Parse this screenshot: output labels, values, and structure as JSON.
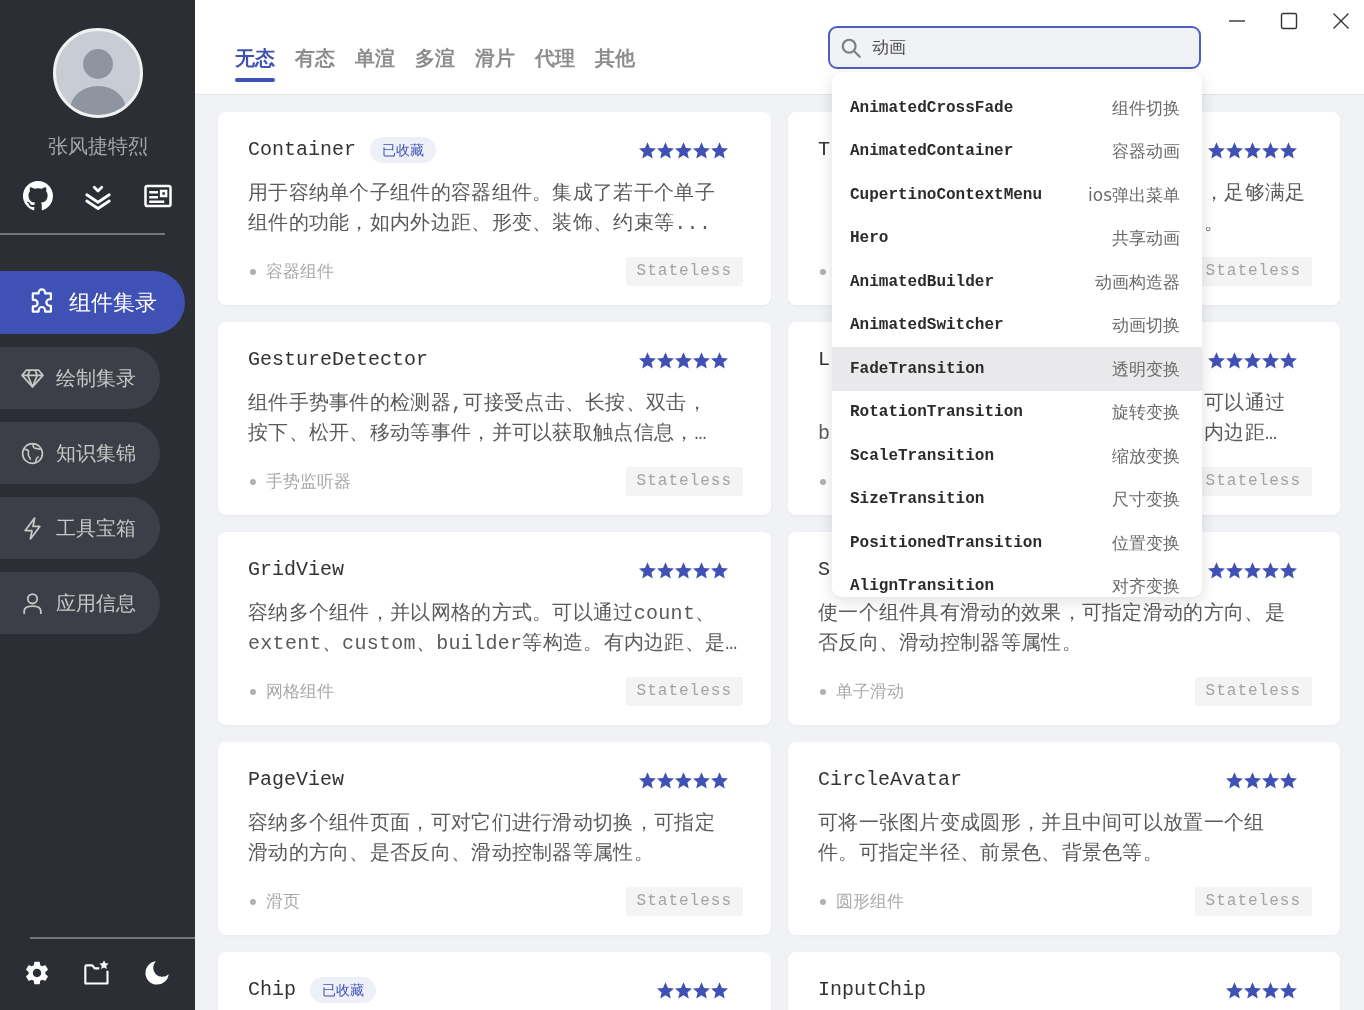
{
  "sidebar": {
    "user_name": "张风捷特烈",
    "nav": [
      {
        "label": "组件集录",
        "selected": true
      },
      {
        "label": "绘制集录",
        "selected": false
      },
      {
        "label": "知识集锦",
        "selected": false
      },
      {
        "label": "工具宝箱",
        "selected": false
      },
      {
        "label": "应用信息",
        "selected": false
      }
    ]
  },
  "tabs": [
    {
      "label": "无态",
      "selected": true
    },
    {
      "label": "有态",
      "selected": false
    },
    {
      "label": "单渲",
      "selected": false
    },
    {
      "label": "多渲",
      "selected": false
    },
    {
      "label": "滑片",
      "selected": false
    },
    {
      "label": "代理",
      "selected": false
    },
    {
      "label": "其他",
      "selected": false
    }
  ],
  "search": {
    "value": "动画"
  },
  "suggestions": [
    {
      "name": "AnimatedCrossFade",
      "summary": "组件切换",
      "highlighted": false
    },
    {
      "name": "AnimatedContainer",
      "summary": "容器动画",
      "highlighted": false
    },
    {
      "name": "CupertinoContextMenu",
      "summary": "ios弹出菜单",
      "highlighted": false
    },
    {
      "name": "Hero",
      "summary": "共享动画",
      "highlighted": false
    },
    {
      "name": "AnimatedBuilder",
      "summary": "动画构造器",
      "highlighted": false
    },
    {
      "name": "AnimatedSwitcher",
      "summary": "动画切换",
      "highlighted": false
    },
    {
      "name": "FadeTransition",
      "summary": "透明变换",
      "highlighted": true
    },
    {
      "name": "RotationTransition",
      "summary": "旋转变换",
      "highlighted": false
    },
    {
      "name": "ScaleTransition",
      "summary": "缩放变换",
      "highlighted": false
    },
    {
      "name": "SizeTransition",
      "summary": "尺寸变换",
      "highlighted": false
    },
    {
      "name": "PositionedTransition",
      "summary": "位置变换",
      "highlighted": false
    },
    {
      "name": "AlignTransition",
      "summary": "对齐变换",
      "highlighted": false
    }
  ],
  "cards": [
    {
      "kind": "full",
      "title": "Container",
      "favorite": "已收藏",
      "stars": 5,
      "description_lines": [
        "用于容纳单个子组件的容器组件。集成了若干个单子",
        "组件的功能，如内外边距、形变、装饰、约束等..."
      ],
      "tag": "容器组件",
      "badge": "Stateless"
    },
    {
      "kind": "covered",
      "title": "T",
      "stars": 5,
      "lines": [
        {
          "after": "，足够满足"
        },
        {
          "after": "。"
        }
      ],
      "badge": "Stateless"
    },
    {
      "kind": "full",
      "title": "GestureDetector",
      "stars": 5,
      "description_lines": [
        "组件手势事件的检测器,可接受点击、长按、双击，",
        "按下、松开、移动等事件，并可以获取触点信息，…"
      ],
      "tag": "手势监听器",
      "badge": "Stateless"
    },
    {
      "kind": "covered",
      "title": "L",
      "stars": 5,
      "lines": [
        {
          "after": "可以通过"
        },
        {
          "before": "b",
          "after": "内边距…"
        }
      ],
      "badge": "Stateless"
    },
    {
      "kind": "full",
      "title": "GridView",
      "stars": 5,
      "description_lines": [
        "容纳多个组件，并以网格的方式。可以通过count、",
        "extent、custom、builder等构造。有内边距、是…"
      ],
      "tag": "网格组件",
      "badge": "Stateless"
    },
    {
      "kind": "full",
      "title": "S",
      "stars": 5,
      "description_lines": [
        "使一个组件具有滑动的效果，可指定滑动的方向、是",
        "否反向、滑动控制器等属性。"
      ],
      "tag": "单子滑动",
      "badge": "Stateless"
    },
    {
      "kind": "full",
      "title": "PageView",
      "stars": 5,
      "description_lines": [
        "容纳多个组件页面，可对它们进行滑动切换，可指定",
        "滑动的方向、是否反向、滑动控制器等属性。"
      ],
      "tag": "滑页",
      "badge": "Stateless"
    },
    {
      "kind": "full",
      "title": "CircleAvatar",
      "stars": 4,
      "description_lines": [
        "可将一张图片变成圆形，并且中间可以放置一个组",
        "件。可指定半径、前景色、背景色等。"
      ],
      "tag": "圆形组件",
      "badge": "Stateless"
    },
    {
      "kind": "full",
      "title": "Chip",
      "favorite": "已收藏",
      "stars": 4
    },
    {
      "kind": "full",
      "title": "InputChip",
      "stars": 4
    }
  ]
}
